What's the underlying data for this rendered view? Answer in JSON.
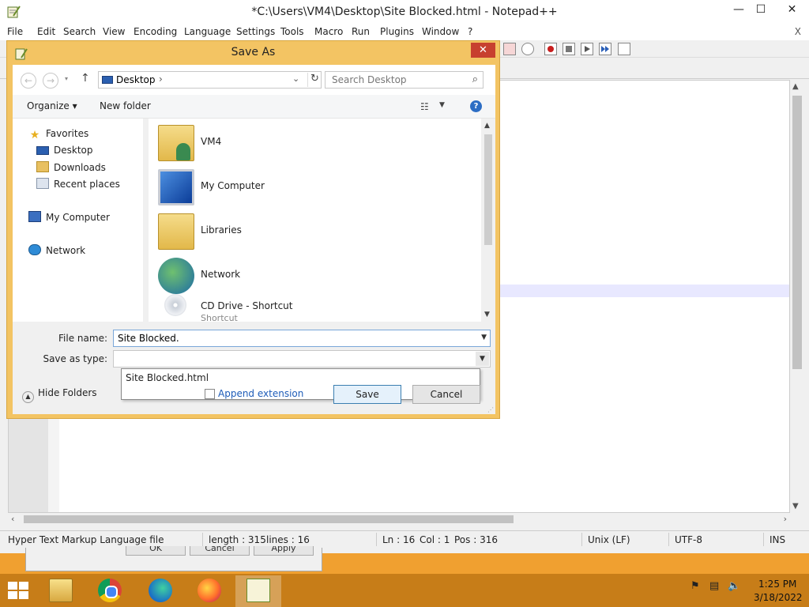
{
  "notepad": {
    "title": "*C:\\Users\\VM4\\Desktop\\Site Blocked.html - Notepad++",
    "minimize": "—",
    "maximize": "☐",
    "close": "✕",
    "menu": [
      "File",
      "Edit",
      "Search",
      "View",
      "Encoding",
      "Language",
      "Settings",
      "Tools",
      "Macro",
      "Run",
      "Plugins",
      "Window",
      "?"
    ],
    "menu_close": "X",
    "status": {
      "file_type": "Hyper Text Markup Language file",
      "length": "length : 315",
      "lines": "lines : 16",
      "ln": "Ln : 16",
      "col": "Col : 1",
      "pos": "Pos : 316",
      "eol": "Unix (LF)",
      "encoding": "UTF-8",
      "mode": "INS"
    }
  },
  "background_dialog": {
    "buttons": [
      "OK",
      "Cancel",
      "Apply"
    ]
  },
  "save_dialog": {
    "title": "Save As",
    "close": "✕",
    "address": {
      "location": "Desktop",
      "chevron": "›",
      "dropdown": "⌄",
      "refresh": "↻"
    },
    "search_placeholder": "Search Desktop",
    "search_icon": "⌕",
    "nav": {
      "back": "←",
      "forward": "→",
      "recent": "▾",
      "up": "↑"
    },
    "toolbar": {
      "organize": "Organize ▾",
      "new_folder": "New folder",
      "views": "☷",
      "views_drop": "▼",
      "help": "?"
    },
    "navigation_pane": [
      {
        "label": "Favorites",
        "icon": "star-icon"
      },
      {
        "label": "Desktop",
        "icon": "desktop-icon"
      },
      {
        "label": "Downloads",
        "icon": "downloads-icon"
      },
      {
        "label": "Recent places",
        "icon": "recent-places-icon"
      },
      {
        "label": "My Computer",
        "icon": "computer-icon"
      },
      {
        "label": "Network",
        "icon": "network-icon"
      }
    ],
    "files": [
      {
        "label": "VM4",
        "icon": "user-folder-icon"
      },
      {
        "label": "My Computer",
        "icon": "computer-icon"
      },
      {
        "label": "Libraries",
        "icon": "libraries-icon"
      },
      {
        "label": "Network",
        "icon": "network-icon"
      },
      {
        "label": "CD Drive - Shortcut",
        "sub": "Shortcut",
        "icon": "cd-drive-icon"
      }
    ],
    "scroll": {
      "up": "▲",
      "down": "▼"
    },
    "file_name_label": "File name:",
    "file_name_value": "Site Blocked.",
    "autocomplete": [
      "Site Blocked.html"
    ],
    "save_as_type_label": "Save as type:",
    "dropdown_arrow": "▼",
    "hide_folders": "Hide Folders",
    "hide_folders_arrow": "▲",
    "append_extension": "Append extension",
    "save": "Save",
    "cancel": "Cancel",
    "grip": "⋰"
  },
  "taskbar": {
    "apps": [
      "file-explorer-icon",
      "chrome-icon",
      "edge-icon",
      "firefox-icon",
      "notepad-plus-plus-icon"
    ],
    "tray": {
      "flag": "⚑",
      "network": "▤",
      "volume": "🔈"
    },
    "time": "1:25 PM",
    "date": "3/18/2022"
  }
}
